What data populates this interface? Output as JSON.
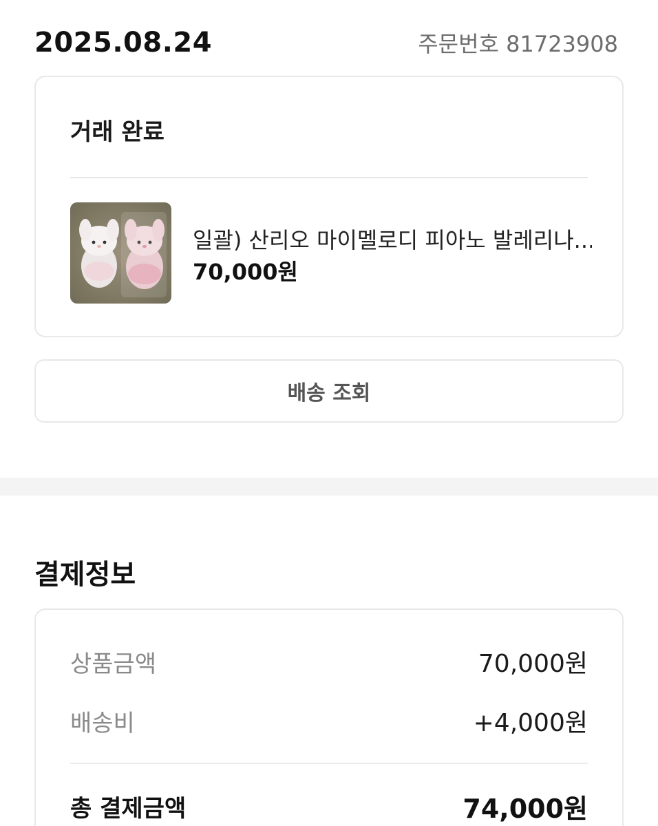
{
  "order": {
    "date": "2025.08.24",
    "number_label": "주문번호 81723908"
  },
  "trade": {
    "status": "거래 완료",
    "product_image": "product-thumbnail-plush-dolls",
    "product_name": "일괄) 산리오 마이멜로디 피아노 발레리나...",
    "product_price": "70,000원"
  },
  "tracking": {
    "button_label": "배송 조회"
  },
  "payment": {
    "title": "결제정보",
    "rows": [
      {
        "label": "상품금액",
        "value": "70,000원"
      },
      {
        "label": "배송비",
        "value": "+4,000원"
      }
    ],
    "total_label": "총 결제금액",
    "total_value": "74,000원"
  },
  "colors": {
    "border": "#e8e8e8",
    "muted_text": "#8a8a8a",
    "section_gap": "#f4f4f4"
  }
}
